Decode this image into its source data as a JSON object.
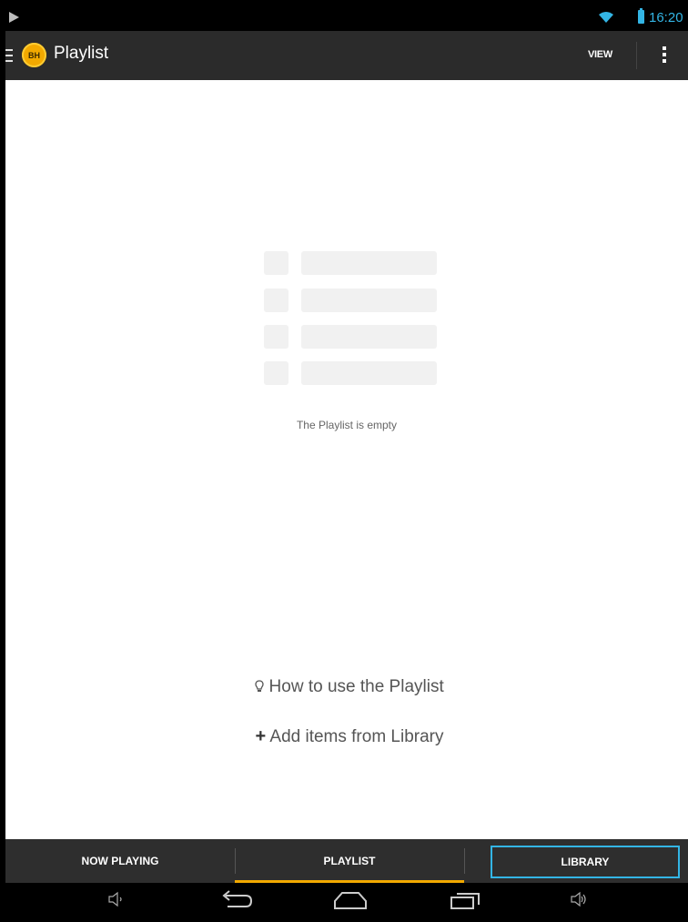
{
  "status": {
    "time": "16:20"
  },
  "actionbar": {
    "title": "Playlist",
    "logo_text": "BH",
    "view_label": "VIEW"
  },
  "empty": {
    "message": "The Playlist is empty"
  },
  "links": {
    "how_to": "How to use the Playlist",
    "add_items": "Add items from Library"
  },
  "tabs": [
    {
      "label": "NOW PLAYING"
    },
    {
      "label": "PLAYLIST"
    },
    {
      "label": "LIBRARY"
    }
  ],
  "colors": {
    "accent": "#f2a900",
    "focus": "#33b5e5"
  },
  "icons": [
    "play-icon",
    "wifi-icon",
    "battery-icon",
    "drawer-icon",
    "overflow-menu-icon",
    "lightbulb-icon",
    "plus-icon",
    "volume-down-icon",
    "back-icon",
    "home-icon",
    "recents-icon",
    "volume-up-icon"
  ]
}
